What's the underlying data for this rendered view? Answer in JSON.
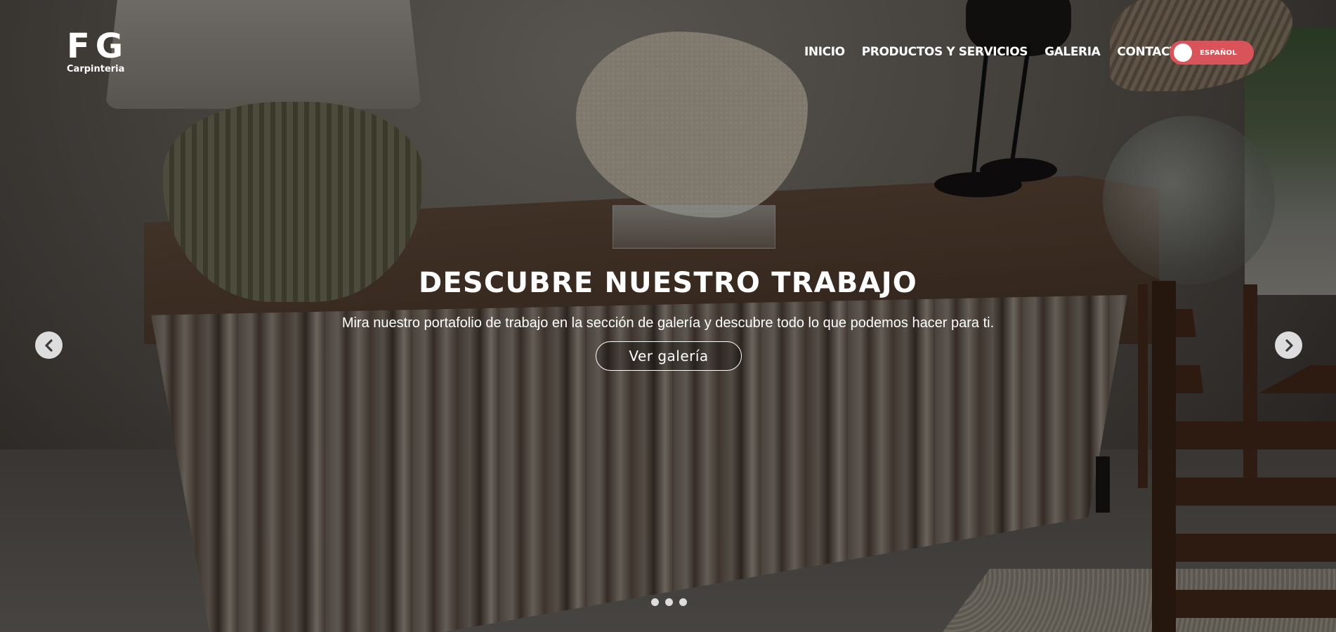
{
  "logo": {
    "mark": "FG",
    "subtitle": "Carpinteria"
  },
  "nav": {
    "items": [
      {
        "label": "INICIO"
      },
      {
        "label": "PRODUCTOS Y SERVICIOS"
      },
      {
        "label": "GALERIA"
      },
      {
        "label": "CONTACTO"
      }
    ]
  },
  "language": {
    "label": "ESPAÑOL",
    "color": "#d9545a"
  },
  "hero": {
    "title": "DESCUBRE NUESTRO TRABAJO",
    "subtitle": "Mira nuestro portafolio de trabajo en la sección de galería y descubre todo lo que podemos hacer para ti.",
    "button_label": "Ver galería",
    "prev_icon": "chevron-left-icon",
    "next_icon": "chevron-right-icon",
    "slide_count": 3
  }
}
